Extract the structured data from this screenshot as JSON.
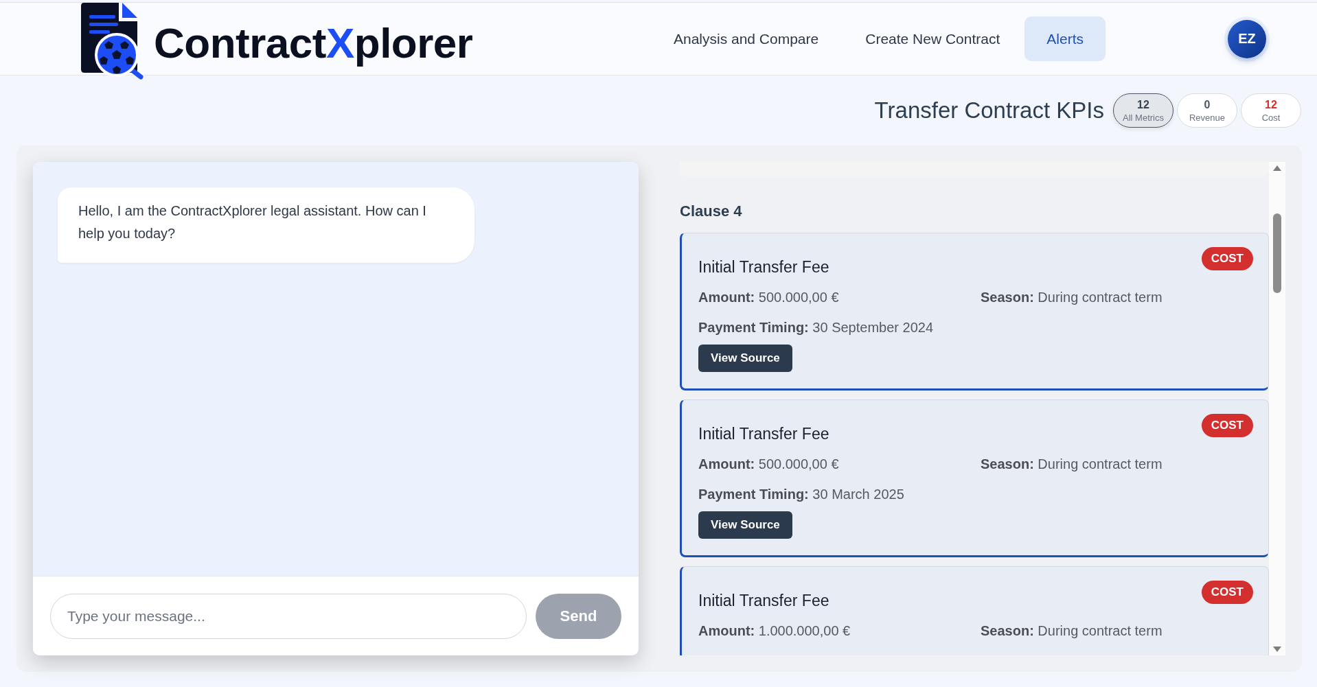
{
  "header": {
    "logo": {
      "name_start": "Contract",
      "name_highlight": "X",
      "name_end": "plorer"
    },
    "nav": [
      {
        "label": "Analysis and Compare",
        "selected": false
      },
      {
        "label": "Create New Contract",
        "selected": false
      },
      {
        "label": "Alerts",
        "selected": true
      }
    ],
    "avatar": {
      "initials": "EZ"
    }
  },
  "kpis": {
    "title": "Transfer Contract KPIs",
    "filters": [
      {
        "kind": "all",
        "count": "12",
        "label": "All Metrics",
        "selected": true
      },
      {
        "kind": "revenue",
        "count": "0",
        "label": "Revenue",
        "selected": false
      },
      {
        "kind": "cost",
        "count": "12",
        "label": "Cost",
        "selected": false
      }
    ]
  },
  "chat": {
    "messages": [
      {
        "kind": "assistant",
        "text": "Hello, I am the ContractXplorer legal assistant. How can I help you today?"
      }
    ],
    "input": {
      "placeholder": "Type your message..."
    },
    "send_button": {
      "label": "Send",
      "disabled": true
    }
  },
  "clauses": {
    "heading": "Clause 4",
    "items": [
      {
        "title": "Initial Transfer Fee",
        "tag": {
          "kind": "cost",
          "label": "COST"
        },
        "fields": [
          {
            "label": "Amount:",
            "value": "500.000,00 €"
          },
          {
            "label": "Season:",
            "value": "During contract term"
          },
          {
            "label": "Payment Timing:",
            "value": "30 September 2024"
          }
        ],
        "button": "View Source"
      },
      {
        "title": "Initial Transfer Fee",
        "tag": {
          "kind": "cost",
          "label": "COST"
        },
        "fields": [
          {
            "label": "Amount:",
            "value": "500.000,00 €"
          },
          {
            "label": "Season:",
            "value": "During contract term"
          },
          {
            "label": "Payment Timing:",
            "value": "30 March 2025"
          }
        ],
        "button": "View Source"
      },
      {
        "title": "Initial Transfer Fee",
        "tag": {
          "kind": "cost",
          "label": "COST"
        },
        "fields": [
          {
            "label": "Amount:",
            "value": "1.000.000,00 €"
          },
          {
            "label": "Season:",
            "value": "During contract term"
          }
        ]
      }
    ]
  }
}
